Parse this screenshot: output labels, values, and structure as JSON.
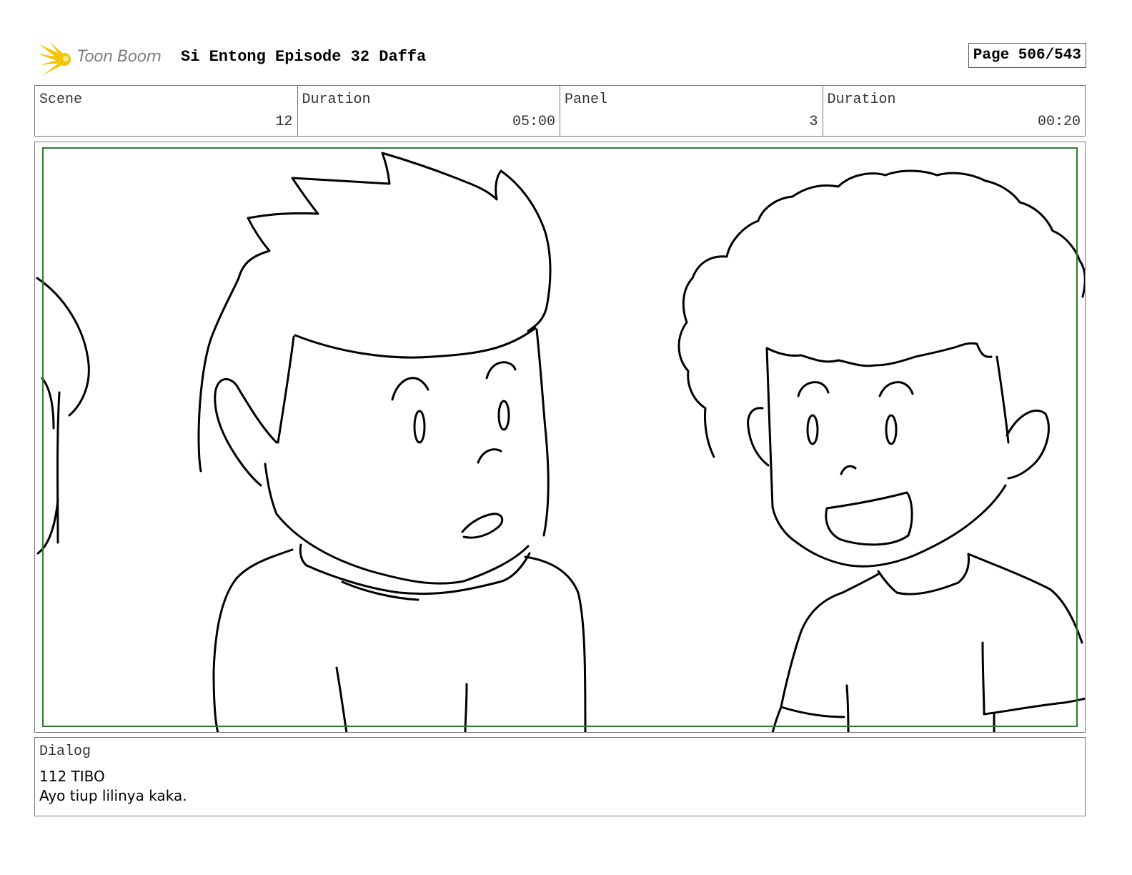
{
  "header": {
    "logo_text": "Toon Boom",
    "title": "Si Entong Episode 32 Daffa",
    "page": "Page 506/543"
  },
  "info": {
    "scene_label": "Scene",
    "scene_value": "12",
    "scene_duration_label": "Duration",
    "scene_duration_value": "05:00",
    "panel_label": "Panel",
    "panel_value": "3",
    "panel_duration_label": "Duration",
    "panel_duration_value": "00:20"
  },
  "dialog": {
    "label": "Dialog",
    "lines": [
      "112 TIBO",
      "Ayo tiup lilinya kaka."
    ]
  },
  "colors": {
    "safe_frame": "#2f7a2f",
    "logo_flare": "#f5c400"
  },
  "icons": {
    "logo": "toon-boom-flare-icon"
  }
}
